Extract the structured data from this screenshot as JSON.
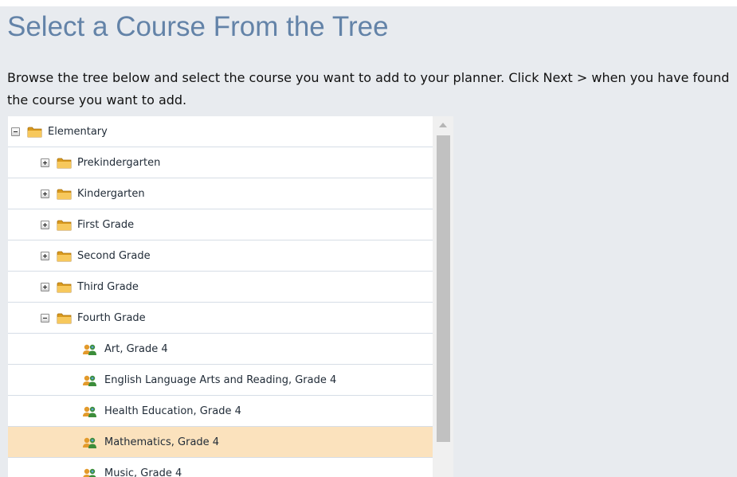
{
  "page": {
    "title": "Select a Course From the Tree",
    "instructions": "Browse the tree below and select the course you want to add to your planner. Click Next > when you have found the course you want to add."
  },
  "tree": {
    "root": {
      "label": "Elementary",
      "expanded": true,
      "icon": "folder-icon"
    },
    "grades": [
      {
        "label": "Prekindergarten",
        "expanded": false,
        "icon": "folder-icon"
      },
      {
        "label": "Kindergarten",
        "expanded": false,
        "icon": "folder-icon"
      },
      {
        "label": "First Grade",
        "expanded": false,
        "icon": "folder-icon"
      },
      {
        "label": "Second Grade",
        "expanded": false,
        "icon": "folder-icon"
      },
      {
        "label": "Third Grade",
        "expanded": false,
        "icon": "folder-icon"
      },
      {
        "label": "Fourth Grade",
        "expanded": true,
        "icon": "folder-icon"
      }
    ],
    "courses": [
      {
        "label": "Art, Grade 4",
        "icon": "course-icon",
        "selected": false
      },
      {
        "label": "English Language Arts and Reading, Grade 4",
        "icon": "course-icon",
        "selected": false
      },
      {
        "label": "Health Education, Grade 4",
        "icon": "course-icon",
        "selected": false
      },
      {
        "label": "Mathematics, Grade 4",
        "icon": "course-icon",
        "selected": true
      },
      {
        "label": "Music, Grade 4",
        "icon": "course-icon",
        "selected": false
      }
    ]
  },
  "colors": {
    "title": "#6383a8",
    "background": "#e8ebef",
    "selected_row": "#fbe2bd",
    "row_divider": "#d6dde6"
  }
}
